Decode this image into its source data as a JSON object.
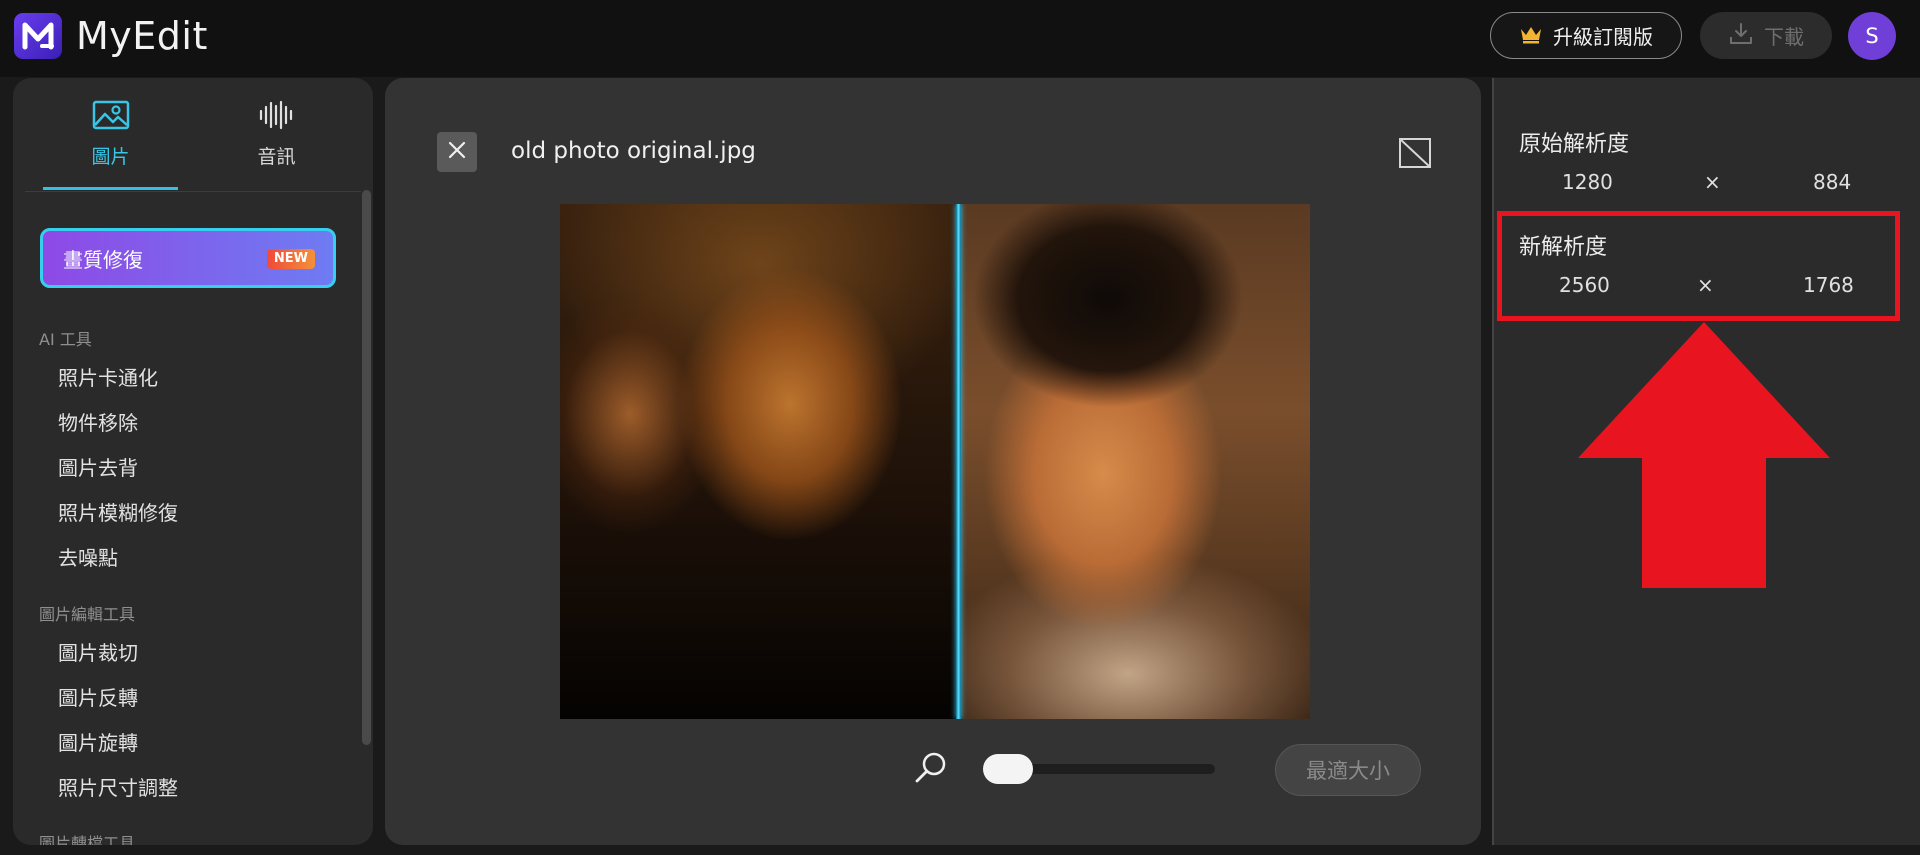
{
  "header": {
    "app_name": "MyEdit",
    "logo_letter": "M",
    "upgrade_label": "升級訂閱版",
    "download_label": "下載",
    "avatar_initial": "S"
  },
  "sidebar": {
    "tabs": [
      {
        "label": "圖片",
        "icon": "image-icon",
        "active": true
      },
      {
        "label": "音訊",
        "icon": "waveform-icon",
        "active": false
      }
    ],
    "featured": {
      "label": "畫質修復",
      "badge": "NEW"
    },
    "sections": [
      {
        "title": "AI 工具",
        "items": [
          "照片卡通化",
          "物件移除",
          "圖片去背",
          "照片模糊修復",
          "去噪點"
        ]
      },
      {
        "title": "圖片編輯工具",
        "items": [
          "圖片裁切",
          "圖片反轉",
          "圖片旋轉",
          "照片尺寸調整"
        ]
      },
      {
        "title": "圖片轉檔工具",
        "items": []
      }
    ]
  },
  "workspace": {
    "filename": "old photo original.jpg",
    "fit_label": "最適大小",
    "zoom_level": 0.0
  },
  "resolution": {
    "original": {
      "title": "原始解析度",
      "width": "1280",
      "times": "×",
      "height": "884"
    },
    "new": {
      "title": "新解析度",
      "width": "2560",
      "times": "×",
      "height": "1768"
    }
  },
  "colors": {
    "accent_cyan": "#36d0ef",
    "feature_gradient_start": "#8e49e6",
    "feature_gradient_end": "#6e7cf2",
    "highlight_red": "#e8141f",
    "avatar_purple": "#6f3fd8"
  }
}
